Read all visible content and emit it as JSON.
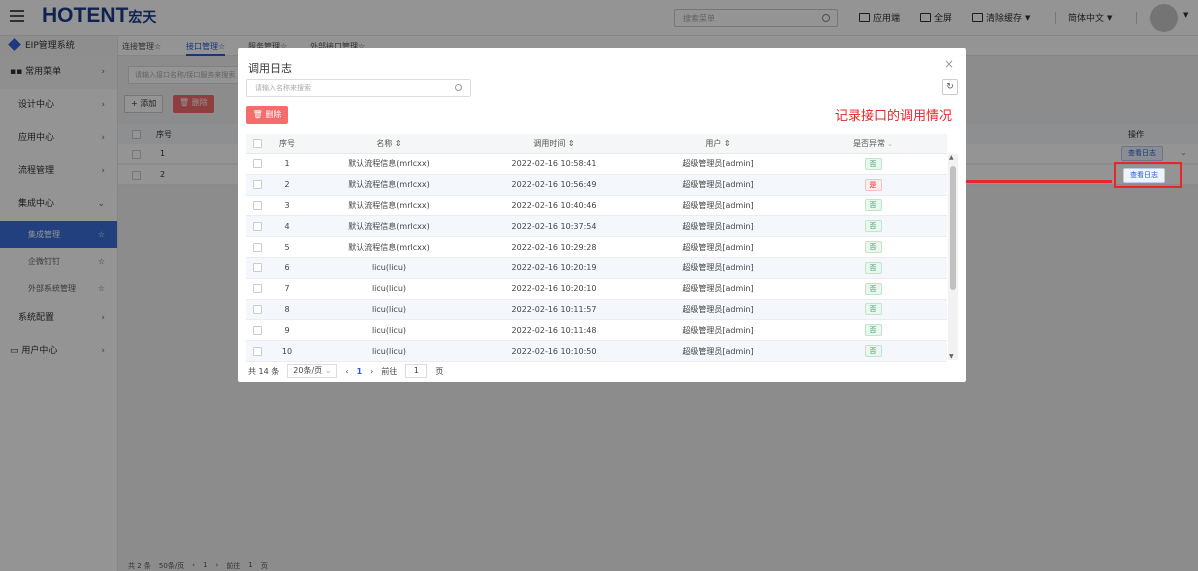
{
  "topbar": {
    "logo_main": "HOTENT",
    "logo_cn": "宏天",
    "search_placeholder": "搜索菜单",
    "app_label": "应用端",
    "fullscreen_label": "全屏",
    "clear_cache_label": "清除缓存",
    "language_label": "简体中文"
  },
  "sidebar": {
    "system_title": "EIP管理系统",
    "common_menu": "常用菜单",
    "items": [
      {
        "label": "设计中心"
      },
      {
        "label": "应用中心"
      },
      {
        "label": "流程管理"
      },
      {
        "label": "集成中心"
      }
    ],
    "sub_items": [
      {
        "label": "集成管理"
      },
      {
        "label": "企微钉钉"
      },
      {
        "label": "外部系统管理"
      }
    ],
    "items_after": [
      {
        "label": "系统配置"
      },
      {
        "label": "用户中心"
      }
    ]
  },
  "bg": {
    "tabs": [
      "连接管理☆",
      "接口管理☆",
      "服务管理☆",
      "外部接口管理☆"
    ],
    "search_placeholder": "请输入接口名称/接口服务来搜索",
    "add_label": "+ 添加",
    "delete_label": "删除",
    "col_index": "序号",
    "col_op": "操作",
    "rows": [
      {
        "index": "1",
        "op": "查看日志"
      },
      {
        "index": "2",
        "op": "查看日志"
      }
    ],
    "pager": {
      "total": "共 2 条",
      "size": "50条/页",
      "page": "1",
      "goto": "前往",
      "goto_val": "1",
      "unit": "页"
    }
  },
  "dialog": {
    "title": "调用日志",
    "search_placeholder": "请输入名称来搜索",
    "delete_label": "删除",
    "annotation": "记录接口的调用情况",
    "columns": {
      "index": "序号",
      "name": "名称 ⇕",
      "time": "调用时间 ⇕",
      "user": "用户 ⇕",
      "exception": "是否异常"
    },
    "rows": [
      {
        "index": "1",
        "name": "默认流程信息(mrlcxx)",
        "time": "2022-02-16 10:58:41",
        "user": "超级管理员[admin]",
        "exception": "否"
      },
      {
        "index": "2",
        "name": "默认流程信息(mrlcxx)",
        "time": "2022-02-16 10:56:49",
        "user": "超级管理员[admin]",
        "exception": "是"
      },
      {
        "index": "3",
        "name": "默认流程信息(mrlcxx)",
        "time": "2022-02-16 10:40:46",
        "user": "超级管理员[admin]",
        "exception": "否"
      },
      {
        "index": "4",
        "name": "默认流程信息(mrlcxx)",
        "time": "2022-02-16 10:37:54",
        "user": "超级管理员[admin]",
        "exception": "否"
      },
      {
        "index": "5",
        "name": "默认流程信息(mrlcxx)",
        "time": "2022-02-16 10:29:28",
        "user": "超级管理员[admin]",
        "exception": "否"
      },
      {
        "index": "6",
        "name": "licu(licu)",
        "time": "2022-02-16 10:20:19",
        "user": "超级管理员[admin]",
        "exception": "否"
      },
      {
        "index": "7",
        "name": "licu(licu)",
        "time": "2022-02-16 10:20:10",
        "user": "超级管理员[admin]",
        "exception": "否"
      },
      {
        "index": "8",
        "name": "licu(licu)",
        "time": "2022-02-16 10:11:57",
        "user": "超级管理员[admin]",
        "exception": "否"
      },
      {
        "index": "9",
        "name": "licu(licu)",
        "time": "2022-02-16 10:11:48",
        "user": "超级管理员[admin]",
        "exception": "否"
      },
      {
        "index": "10",
        "name": "licu(licu)",
        "time": "2022-02-16 10:10:50",
        "user": "超级管理员[admin]",
        "exception": "否"
      }
    ],
    "pager": {
      "total": "共 14 条",
      "size": "20条/页",
      "page": "1",
      "goto": "前往",
      "goto_val": "1",
      "unit": "页"
    }
  },
  "colors": {
    "accent": "#2a5bd7",
    "danger": "#e5262a",
    "delete_btn": "#f56c6c",
    "success": "#38a169"
  }
}
